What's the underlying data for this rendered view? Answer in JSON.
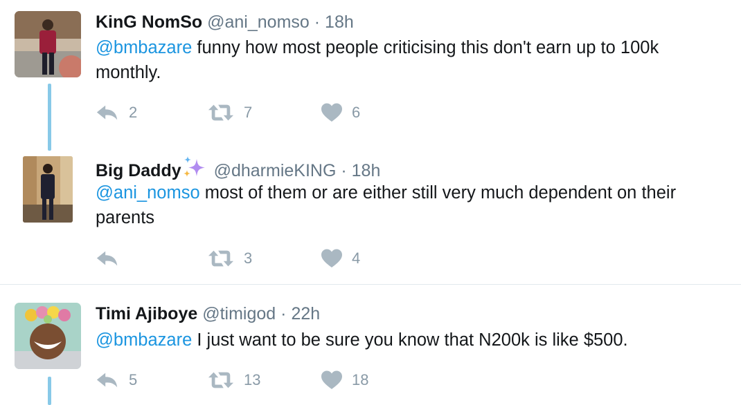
{
  "colors": {
    "mention": "#1b95e0",
    "muted": "#657786",
    "action_icon": "#aab8c2",
    "thread_line": "#88c9e8"
  },
  "tweets": [
    {
      "name": "KinG NomSo",
      "handle": "@ani_nomso",
      "separator": "·",
      "time": "18h",
      "mention": "@bmbazare",
      "text_line1": " funny how most people criticising this don't earn up to 100k",
      "text_line2": "monthly.",
      "replies": "2",
      "retweets": "7",
      "likes": "6"
    },
    {
      "name": "Big Daddy",
      "name_emoji": "sparkles-icon",
      "handle": "@dharmieKING",
      "separator": "·",
      "time": "18h",
      "mention": "@ani_nomso",
      "text_line1": " most of them or are either still very much dependent on their",
      "text_line2": "parents",
      "replies": "",
      "retweets": "3",
      "likes": "4"
    },
    {
      "name": "Timi Ajiboye",
      "handle": "@timigod",
      "separator": "·",
      "time": "22h",
      "mention": "@bmbazare",
      "text_line1": " I just want to be sure you know that N200k is like $500.",
      "replies": "5",
      "retweets": "13",
      "likes": "18"
    }
  ]
}
